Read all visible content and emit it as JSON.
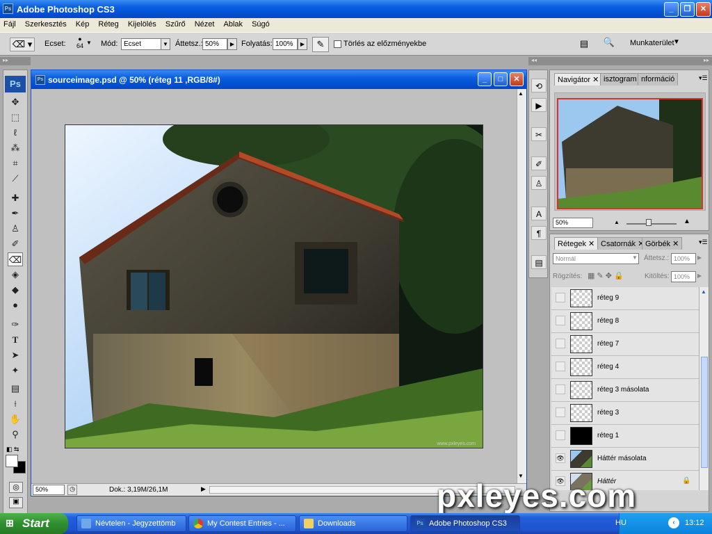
{
  "app": {
    "title": "Adobe Photoshop CS3",
    "logo": "Ps"
  },
  "menu": [
    "Fájl",
    "Szerkesztés",
    "Kép",
    "Réteg",
    "Kijelölés",
    "Szűrő",
    "Nézet",
    "Ablak",
    "Súgó"
  ],
  "options": {
    "brush_label": "Ecset:",
    "brush_size": "64",
    "mode_label": "Mód:",
    "mode_value": "Ecset",
    "opacity_label": "Áttetsz.:",
    "opacity_value": "50%",
    "flow_label": "Folyatás:",
    "flow_value": "100%",
    "erase_history_label": "Törlés az előzményekbe",
    "workspace_label": "Munkaterület"
  },
  "document": {
    "title": "sourceimage.psd @ 50% (réteg 11 ,RGB/8#)",
    "zoom": "50%",
    "doc_info": "Dok.: 3,19M/26,1M",
    "image_credit": "www.pxleyes.com"
  },
  "navigator": {
    "tabs": [
      "Navigátor",
      "isztogram",
      "nformáció"
    ],
    "zoom": "50%"
  },
  "layers_panel": {
    "tabs": [
      "Rétegek",
      "Csatornák",
      "Görbék"
    ],
    "blend_mode": "Normál",
    "opacity_label": "Áttetsz.:",
    "opacity_value": "100%",
    "lock_label": "Rögzítés:",
    "fill_label": "Kitöltés:",
    "fill_value": "100%",
    "layers": [
      "réteg 9",
      "réteg 8",
      "réteg 7",
      "réteg 4",
      "réteg 3 másolata",
      "réteg 3",
      "réteg 1",
      "Háttér másolata",
      "Háttér"
    ]
  },
  "taskbar": {
    "start": "Start",
    "tasks": [
      "Névtelen - Jegyzettömb",
      "My Contest Entries - ...",
      "Downloads",
      "Adobe Photoshop CS3"
    ],
    "lang": "HU",
    "time": "13:12"
  },
  "watermark": "pxleyes.com",
  "colors": {
    "xp_blue": "#0a5ee0",
    "ps_blue": "#1c4fa6",
    "start_green": "#2f8f2f"
  }
}
